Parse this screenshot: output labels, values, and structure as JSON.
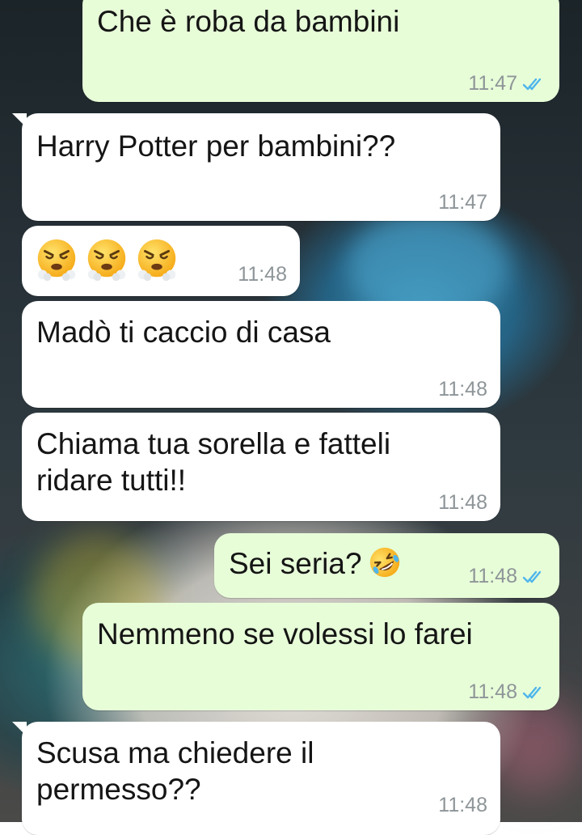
{
  "chat": {
    "messages": [
      {
        "direction": "out",
        "text": "Che è roba da bambini",
        "time": "11:47",
        "status": "read"
      },
      {
        "direction": "in",
        "text": "Harry Potter per bambini??",
        "time": "11:47"
      },
      {
        "direction": "in",
        "emojis": [
          "face-with-steam-from-nose",
          "face-with-steam-from-nose",
          "face-with-steam-from-nose"
        ],
        "time": "11:48"
      },
      {
        "direction": "in",
        "text": "Madò ti caccio di casa",
        "time": "11:48"
      },
      {
        "direction": "in",
        "text_lines": [
          "Chiama tua sorella e fatteli",
          "ridare tutti!!"
        ],
        "time": "11:48"
      },
      {
        "direction": "out",
        "text": "Sei seria?",
        "emoji": "rolling-on-floor-laughing",
        "time": "11:48",
        "status": "read"
      },
      {
        "direction": "out",
        "text": "Nemmeno se volessi lo farei",
        "time": "11:48",
        "status": "read"
      },
      {
        "direction": "in",
        "text_lines": [
          "Scusa ma chiedere il",
          "permesso??"
        ],
        "time": "11:48"
      }
    ]
  },
  "colors": {
    "incoming_bubble": "#ffffff",
    "outgoing_bubble": "#e7fdd8",
    "read_ticks": "#4fb6ec",
    "timestamp": "#8e9598"
  },
  "icons": {
    "read_receipt": "double-check-icon",
    "angry_emoji": "face-with-steam-from-nose-emoji",
    "laughing_emoji": "rolling-on-floor-laughing-emoji"
  }
}
